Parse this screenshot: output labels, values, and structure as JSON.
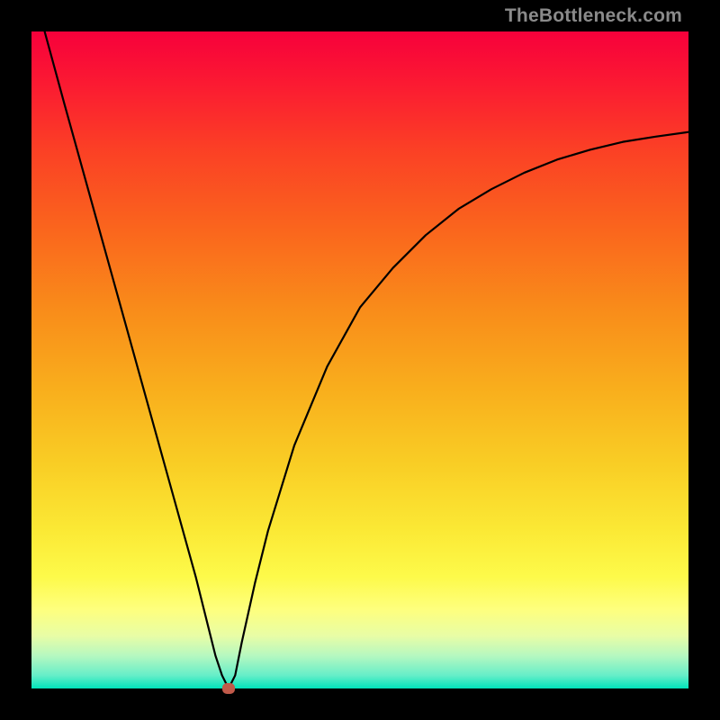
{
  "watermark": "TheBottleneck.com",
  "chart_data": {
    "type": "line",
    "title": "",
    "xlabel": "",
    "ylabel": "",
    "xlim": [
      0,
      100
    ],
    "ylim": [
      0,
      100
    ],
    "grid": false,
    "gradient_background": {
      "top_color": "#f7003b",
      "bottom_color": "#00e3bb",
      "stops": [
        "red",
        "orange",
        "yellow",
        "green"
      ]
    },
    "series": [
      {
        "name": "bottleneck-curve",
        "color": "#000000",
        "x": [
          2,
          5,
          10,
          15,
          20,
          25,
          27,
          28,
          29,
          30,
          31,
          32,
          34,
          36,
          40,
          45,
          50,
          55,
          60,
          65,
          70,
          75,
          80,
          85,
          90,
          95,
          100
        ],
        "y": [
          100,
          89,
          71,
          53,
          35,
          17,
          9,
          5,
          2,
          0,
          2,
          7,
          16,
          24,
          37,
          49,
          58,
          64,
          69,
          73,
          76,
          78.5,
          80.5,
          82,
          83.2,
          84,
          84.7
        ]
      }
    ],
    "marker": {
      "name": "minimum-point",
      "x": 30,
      "y": 0,
      "color": "#c15a4a"
    }
  }
}
